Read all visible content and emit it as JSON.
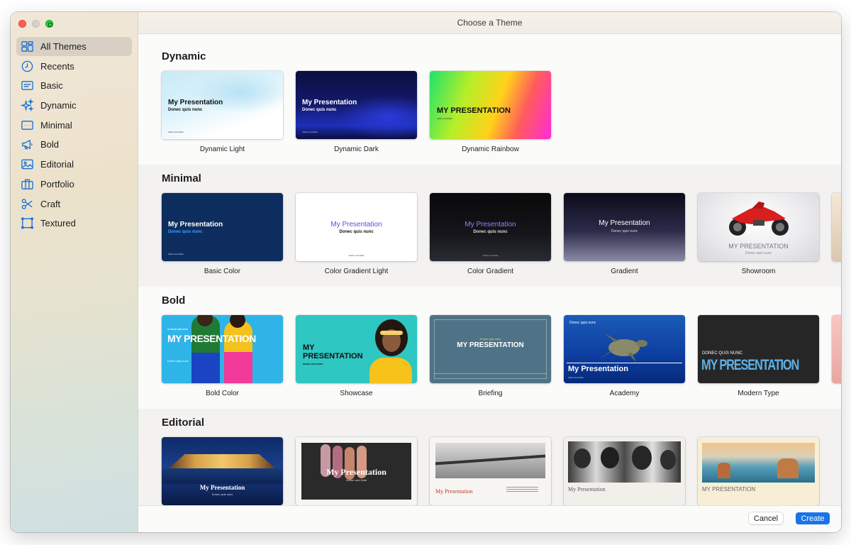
{
  "window": {
    "title": "Choose a Theme"
  },
  "sidebar": {
    "items": [
      {
        "label": "All Themes",
        "icon": "grid-icon",
        "selected": true
      },
      {
        "label": "Recents",
        "icon": "clock-icon"
      },
      {
        "label": "Basic",
        "icon": "basic-slide-icon"
      },
      {
        "label": "Dynamic",
        "icon": "sparkles-icon"
      },
      {
        "label": "Minimal",
        "icon": "minimal-slide-icon"
      },
      {
        "label": "Bold",
        "icon": "megaphone-icon"
      },
      {
        "label": "Editorial",
        "icon": "photo-icon"
      },
      {
        "label": "Portfolio",
        "icon": "briefcase-icon"
      },
      {
        "label": "Craft",
        "icon": "scissors-icon"
      },
      {
        "label": "Textured",
        "icon": "textured-frame-icon"
      }
    ]
  },
  "sections": {
    "dynamic": {
      "title": "Dynamic",
      "themes": [
        {
          "name": "Dynamic Light",
          "title": "My Presentation",
          "subtitle": "Donec quis nunc",
          "author": "Author and Date"
        },
        {
          "name": "Dynamic Dark",
          "title": "My Presentation",
          "subtitle": "Donec quis nunc",
          "author": "Author and Date"
        },
        {
          "name": "Dynamic Rainbow",
          "title": "MY PRESENTATION",
          "subtitle": "Author and Date"
        }
      ]
    },
    "minimal": {
      "title": "Minimal",
      "themes": [
        {
          "name": "Basic Color",
          "title": "My Presentation",
          "subtitle": "Donec quis nunc",
          "author": "Author and Date"
        },
        {
          "name": "Color Gradient Light",
          "title": "My Presentation",
          "subtitle": "Donec quis nunc",
          "author": "Author and Date"
        },
        {
          "name": "Color Gradient",
          "title": "My Presentation",
          "subtitle": "Donec quis nunc",
          "author": "Author and Date"
        },
        {
          "name": "Gradient",
          "title": "My Presentation",
          "subtitle": "Donec quis nunc"
        },
        {
          "name": "Showroom",
          "title": "MY PRESENTATION",
          "subtitle": "Donec quis nunc"
        }
      ]
    },
    "bold": {
      "title": "Bold",
      "themes": [
        {
          "name": "Bold Color",
          "title": "MY PRESENTATION",
          "subtitle": "Donec quis nunc",
          "author": "AUTHOR AND DATE"
        },
        {
          "name": "Showcase",
          "title": "MY PRESENTATION",
          "subtitle": "DONEC QUIS NUNC"
        },
        {
          "name": "Briefing",
          "title": "MY PRESENTATION",
          "subtitle": "Donec quis nunc"
        },
        {
          "name": "Academy",
          "title": "My Presentation",
          "subtitle": "Donec quis nunc",
          "author": "Author and Date"
        },
        {
          "name": "Modern Type",
          "title": "MY PRESENTATION",
          "subtitle": "DONEC QUIS NUNC"
        }
      ]
    },
    "editorial": {
      "title": "Editorial",
      "themes": [
        {
          "title": "My Presentation",
          "subtitle": "Donec quis nunc"
        },
        {
          "title": "My Presentation",
          "subtitle": "Author and Date"
        },
        {
          "title": "My Presentation"
        },
        {
          "title": "My Presentation"
        },
        {
          "title": "MY PRESENTATION"
        }
      ]
    }
  },
  "footer": {
    "cancel_label": "Cancel",
    "create_label": "Create"
  },
  "colors": {
    "accent": "#1a73e8",
    "sidebar_icon": "#1470d9"
  }
}
